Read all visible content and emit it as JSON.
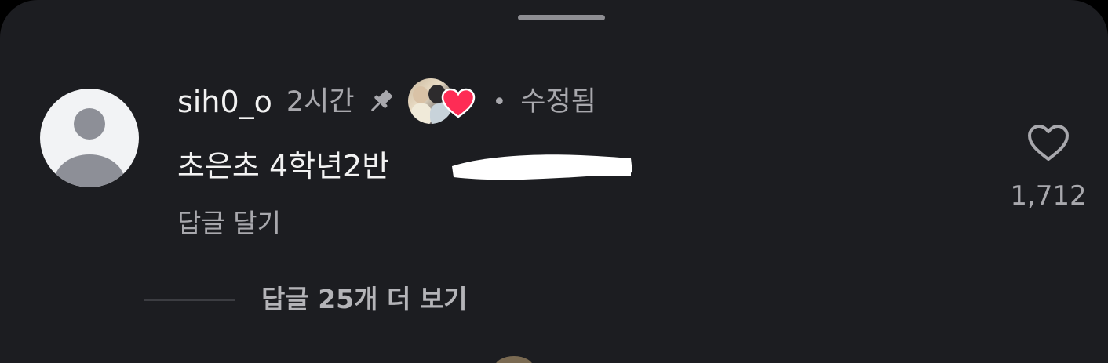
{
  "comment": {
    "username": "sih0_o",
    "time": "2시간",
    "separator": "•",
    "edited_label": "수정됨",
    "text": "초은초 4학년2반",
    "reply_label": "답글 달기",
    "like_count": "1,712"
  },
  "replies": {
    "view_more_label": "답글 25개 더 보기"
  },
  "icons": {
    "pin": "pin-icon",
    "liker_avatar": "liked-by-author-avatar",
    "heart_filled": "heart-filled-icon",
    "heart_outline": "heart-outline-icon",
    "default_avatar": "default-avatar-icon"
  },
  "colors": {
    "background": "#1c1d21",
    "primary_text": "#f2f2f2",
    "secondary_text": "#a8a8ad",
    "heart_red": "#fe2c55"
  }
}
